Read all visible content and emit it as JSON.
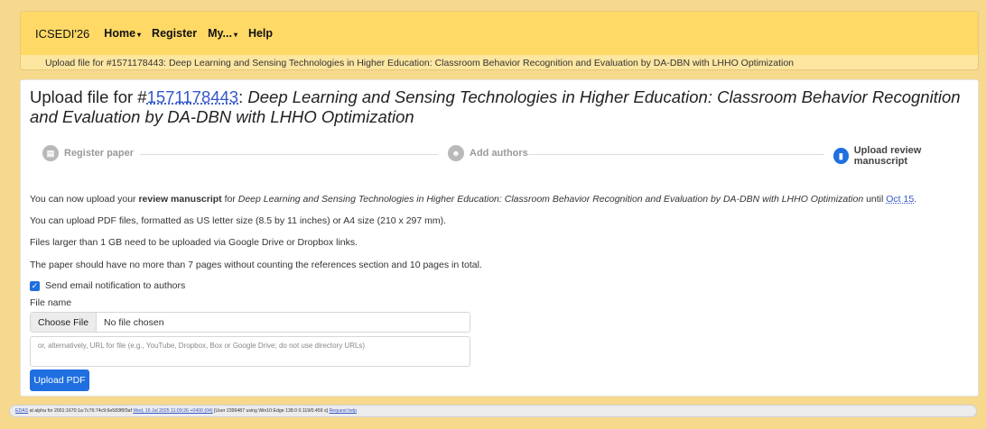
{
  "nav": {
    "brand": "ICSEDI'26",
    "items": [
      {
        "label": "Home",
        "caret": "▾"
      },
      {
        "label": "Register",
        "caret": ""
      },
      {
        "label": "My...",
        "caret": "▾"
      },
      {
        "label": "Help",
        "caret": ""
      }
    ]
  },
  "breadcrumb": "Upload file for #1571178443: Deep Learning and Sensing Technologies in Higher Education: Classroom Behavior Recognition and Evaluation by DA-DBN with LHHO Optimization",
  "heading": {
    "prefix": "Upload file for #",
    "paper_id": "1571178443",
    "colon": ": ",
    "title": "Deep Learning and Sensing Technologies in Higher Education: Classroom Behavior Recognition and Evaluation by DA-DBN with LHHO Optimization"
  },
  "steps": [
    {
      "label": "Register paper",
      "icon": "register-icon",
      "active": false
    },
    {
      "label": "Add authors",
      "icon": "authors-icon",
      "active": false
    },
    {
      "label": "Upload review manuscript",
      "icon": "upload-doc-icon",
      "active": true
    }
  ],
  "info": {
    "line1_a": "You can now upload your ",
    "line1_b": "review manuscript",
    "line1_c": " for ",
    "line1_title": "Deep Learning and Sensing Technologies in Higher Education: Classroom Behavior Recognition and Evaluation by DA-DBN with LHHO Optimization",
    "line1_d": " until ",
    "line1_deadline": "Oct 15",
    "line1_e": ".",
    "line2": "You can upload PDF files, formatted as US letter size (8.5 by 11 inches) or A4 size (210 x 297 mm).",
    "line3": "Files larger than 1 GB need to be uploaded via Google Drive or Dropbox links.",
    "line4": "The paper should have no more than 7 pages without counting the references section and 10 pages in total."
  },
  "form": {
    "notify_label": "Send email notification to authors",
    "notify_checked": true,
    "file_label": "File name",
    "choose_label": "Choose File",
    "no_file": "No file chosen",
    "url_placeholder": "or, alternatively, URL for file (e.g., YouTube, Dropbox, Box or Google Drive; do not use directory URLs)",
    "upload_button": "Upload PDF"
  },
  "footer": {
    "edas": "EDAS",
    "text_a": " at alpha for 2001:1670:1a:7c76:74c9:6e583f6f3af ",
    "date": "Wed, 16 Jul 2025 11:09:26 +0400 (04)",
    "text_b": " [User 2399487 using Win10:Edge 138.0 0.119/0.459 s] ",
    "help": "Request help"
  },
  "colors": {
    "accent": "#1f6fe0",
    "navbar": "#ffd966",
    "link": "#3457c8"
  }
}
